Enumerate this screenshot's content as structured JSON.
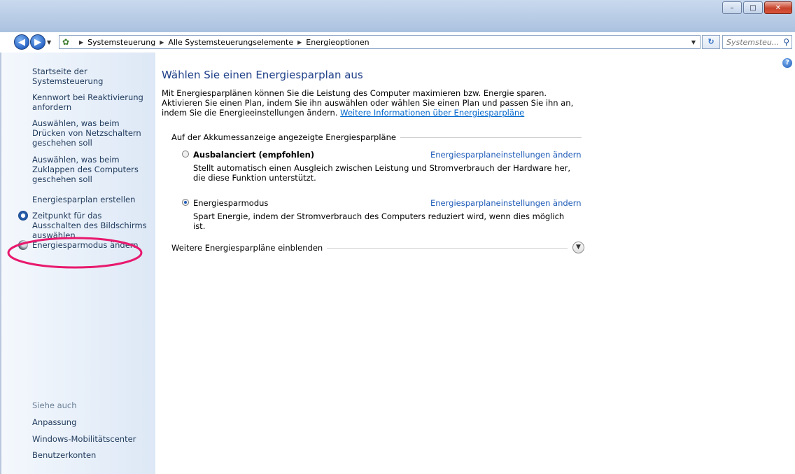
{
  "window": {
    "controls": {
      "minimize": "–",
      "maximize": "□",
      "close": "✕"
    }
  },
  "address": {
    "crumbs": [
      "Systemsteuerung",
      "Alle Systemsteuerungselemente",
      "Energieoptionen"
    ],
    "search_placeholder": "Systemsteu..."
  },
  "sidebar": {
    "items": [
      {
        "label": "Startseite der Systemsteuerung"
      },
      {
        "label": "Kennwort bei Reaktivierung anfordern"
      },
      {
        "label": "Auswählen, was beim Drücken von Netzschaltern geschehen soll"
      },
      {
        "label": "Auswählen, was beim Zuklappen des Computers geschehen soll"
      },
      {
        "label": "Energiesparplan erstellen"
      },
      {
        "label": "Zeitpunkt für das Ausschalten des Bildschirms auswählen",
        "icon": "clock-icon"
      },
      {
        "label": "Energiesparmodus ändern",
        "icon": "sleep-moon-icon"
      }
    ],
    "see_also_title": "Siehe auch",
    "see_also": [
      {
        "label": "Anpassung"
      },
      {
        "label": "Windows-Mobilitätscenter"
      },
      {
        "label": "Benutzerkonten"
      }
    ]
  },
  "main": {
    "heading": "Wählen Sie einen Energiesparplan aus",
    "intro_text": "Mit Energiesparplänen können Sie die Leistung des Computer maximieren bzw. Energie sparen. Aktivieren Sie einen Plan, indem Sie ihn auswählen oder wählen Sie einen Plan und passen Sie ihn an, indem Sie die Energieeinstellungen ändern.",
    "intro_link": "Weitere Informationen über Energiesparpläne",
    "group_label": "Auf der Akkumessanzeige angezeigte Energiesparpläne",
    "plans": [
      {
        "name": "Ausbalanciert (empfohlen)",
        "selected": false,
        "link": "Energiesparplaneinstellungen ändern",
        "description": "Stellt automatisch einen Ausgleich zwischen Leistung und Stromverbrauch der Hardware her, die diese Funktion unterstützt."
      },
      {
        "name": "Energiesparmodus",
        "selected": true,
        "link": "Energiesparplaneinstellungen ändern",
        "description": "Spart Energie, indem der Stromverbrauch des Computers reduziert wird, wenn dies möglich ist."
      }
    ],
    "more_plans_label": "Weitere Energiesparpläne einblenden"
  },
  "annotation": {
    "color": "#e8196e"
  }
}
